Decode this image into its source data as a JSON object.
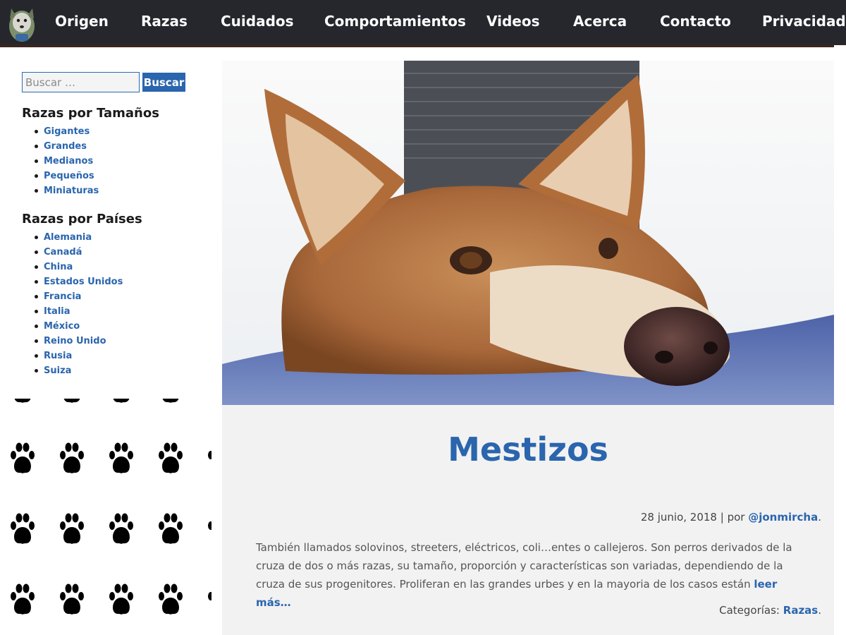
{
  "nav": {
    "items": [
      "Origen",
      "Razas",
      "Cuidados",
      "Comportamientos",
      "Videos",
      "Acerca",
      "Contacto",
      "Privacidad"
    ]
  },
  "search": {
    "placeholder": "Buscar …",
    "button_label": "Buscar"
  },
  "sidebar": {
    "sizes_heading": "Razas por Tamaños",
    "sizes": [
      "Gigantes",
      "Grandes",
      "Medianos",
      "Pequeños",
      "Miniaturas"
    ],
    "countries_heading": "Razas por Países",
    "countries": [
      "Alemania",
      "Canadá",
      "China",
      "Estados Unidos",
      "Francia",
      "Italia",
      "México",
      "Reino Unido",
      "Rusia",
      "Suiza"
    ]
  },
  "article": {
    "title": "Mestizos",
    "date": "28 junio, 2018",
    "by": "| por",
    "author": "@jonmircha",
    "excerpt": "También llamados solovinos, streeters, eléctricos, coli…entes o callejeros. Son perros derivados de la cruza de dos o más razas, su tamaño, proporción y características son variadas, dependiendo de la cruza de sus progenitores. Proliferan en las grandes urbes y en la mayoria de los casos están",
    "read_more": "leer más…",
    "categories_label": "Categorías:",
    "category": "Razas"
  },
  "colors": {
    "nav_bg": "#25272d",
    "accent": "#2a65ae",
    "article_bg": "#f2f2f2"
  },
  "icons": [
    "site-logo-icon",
    "paw-icon",
    "dog-photo"
  ]
}
